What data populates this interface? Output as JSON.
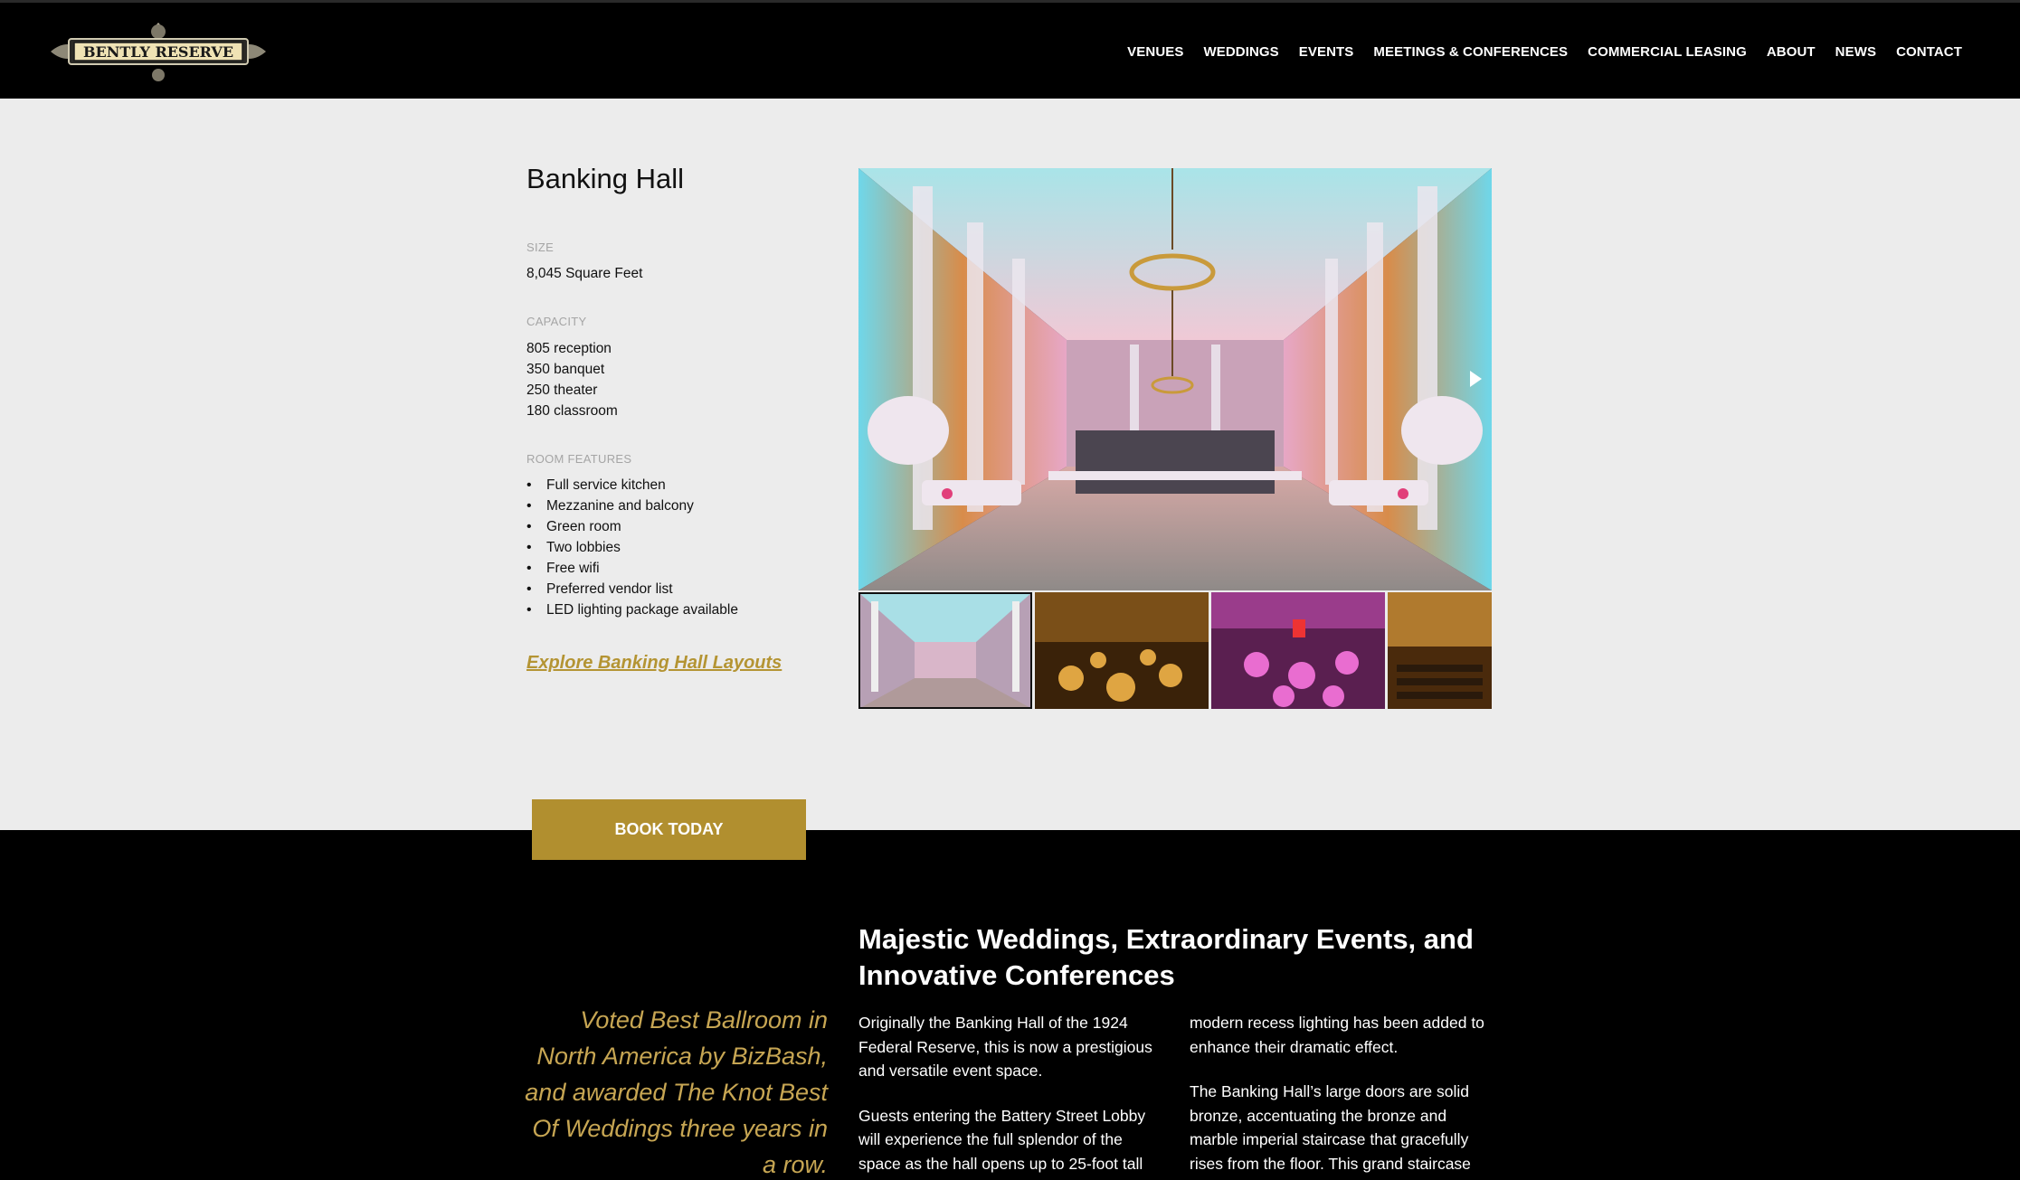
{
  "brand": {
    "logo_text": "BENTLY RESERVE"
  },
  "nav": {
    "items": [
      "VENUES",
      "WEDDINGS",
      "EVENTS",
      "MEETINGS & CONFERENCES",
      "COMMERCIAL LEASING",
      "ABOUT",
      "NEWS",
      "CONTACT"
    ]
  },
  "venue": {
    "title": "Banking Hall",
    "size_label": "SIZE",
    "size_value": "8,045 Square Feet",
    "capacity_label": "CAPACITY",
    "capacity": [
      "805 reception",
      "350 banquet",
      "250 theater",
      "180 classroom"
    ],
    "features_label": "ROOM FEATURES",
    "features": [
      "Full service kitchen",
      "Mezzanine and balcony",
      "Green room",
      "Two lobbies",
      "Free wifi",
      "Preferred vendor list",
      "LED lighting package available"
    ],
    "explore_link": "Explore Banking Hall Layouts"
  },
  "gallery": {
    "thumbnail_count": 4,
    "active_index": 0
  },
  "cta": {
    "book_label": "BOOK TODAY"
  },
  "about": {
    "quote": "Voted Best Ballroom in North America by BizBash, and awarded The Knot Best Of Weddings three years in a row.",
    "heading": "Majestic Weddings, Extraordinary Events, and Innovative Conferences",
    "col1_p1": "Originally the Banking Hall of the 1924 Federal Reserve, this is now a prestigious and versatile event space.",
    "col1_p2": "Guests entering the Battery Street Lobby will experience the full splendor of the space as the hall opens up to 25-foot tall",
    "col2_p1": "modern recess lighting has been added to enhance their dramatic effect.",
    "col2_p2": "The Banking Hall’s large doors are solid bronze, accentuating the bronze and marble imperial staircase that gracefully rises from the floor. This grand staircase"
  },
  "colors": {
    "accent": "#b18f2f",
    "quote": "#c7a653",
    "header_bg": "#000000",
    "light_bg": "#ececec"
  }
}
